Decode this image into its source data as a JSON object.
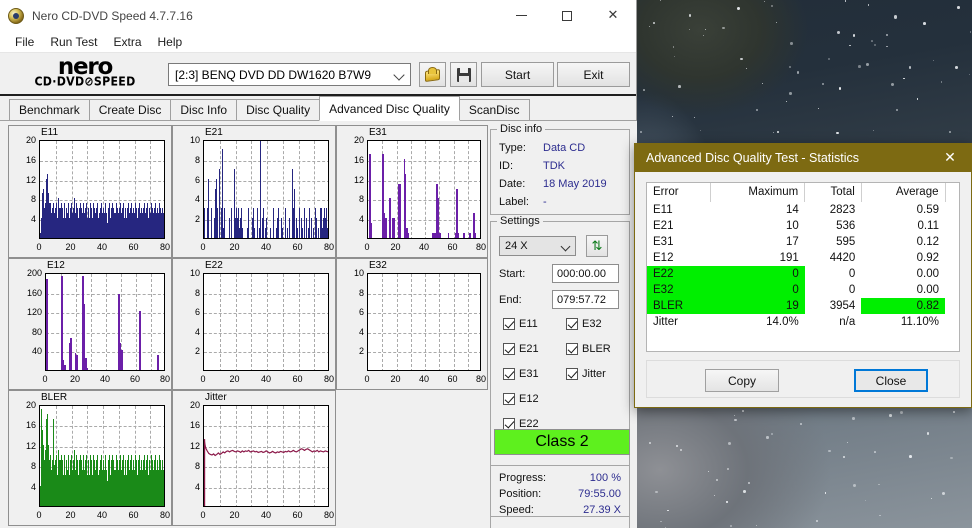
{
  "window": {
    "title": "Nero CD-DVD Speed 4.7.7.16",
    "app_icon": "nero-disc-icon",
    "minimize": "minimize-icon",
    "maximize": "maximize-icon",
    "close": "close-icon"
  },
  "menu": {
    "items": [
      "File",
      "Run Test",
      "Extra",
      "Help"
    ]
  },
  "logo": {
    "line1": "nero",
    "line2": "CD·DVD⊘SPEED"
  },
  "toolbar": {
    "drive": "[2:3]   BENQ DVD DD DW1620 B7W9",
    "eject_icon": "eject-disc-icon",
    "save_icon": "floppy-save-icon",
    "start_label": "Start",
    "exit_label": "Exit"
  },
  "tabs": [
    {
      "label": "Benchmark",
      "active": false
    },
    {
      "label": "Create Disc",
      "active": false
    },
    {
      "label": "Disc Info",
      "active": false
    },
    {
      "label": "Disc Quality",
      "active": false
    },
    {
      "label": "Advanced Disc Quality",
      "active": true
    },
    {
      "label": "ScanDisc",
      "active": false
    }
  ],
  "disc_info": {
    "legend": "Disc info",
    "rows": [
      {
        "label": "Type:",
        "value": "Data CD"
      },
      {
        "label": "ID:",
        "value": "TDK"
      },
      {
        "label": "Date:",
        "value": "18 May 2019"
      },
      {
        "label": "Label:",
        "value": "-"
      }
    ]
  },
  "settings": {
    "legend": "Settings",
    "speed": "24 X",
    "refresh_icon": "refresh-arrows-icon",
    "start_label": "Start:",
    "start_value": "000:00.00",
    "end_label": "End:",
    "end_value": "079:57.72",
    "checkboxes_left": [
      {
        "label": "E11",
        "checked": true
      },
      {
        "label": "E21",
        "checked": true
      },
      {
        "label": "E31",
        "checked": true
      },
      {
        "label": "E12",
        "checked": true
      },
      {
        "label": "E22",
        "checked": true
      }
    ],
    "checkboxes_right": [
      {
        "label": "E32",
        "checked": true
      },
      {
        "label": "BLER",
        "checked": true
      },
      {
        "label": "Jitter",
        "checked": true
      }
    ]
  },
  "class_box": {
    "label": "Class 2",
    "color": "#5ef01e"
  },
  "progress": {
    "rows": [
      {
        "label": "Progress:",
        "value": "100 %"
      },
      {
        "label": "Position:",
        "value": "79:55.00"
      },
      {
        "label": "Speed:",
        "value": "27.39 X"
      }
    ]
  },
  "dialog": {
    "title": "Advanced Disc Quality Test - Statistics",
    "close_icon": "close-icon",
    "columns": [
      "Error",
      "Maximum",
      "Total",
      "Average"
    ],
    "rows": [
      {
        "error": "E11",
        "maximum": "14",
        "total": "2823",
        "average": "0.59",
        "hl_left": false,
        "hl_avg": false
      },
      {
        "error": "E21",
        "maximum": "10",
        "total": "536",
        "average": "0.11",
        "hl_left": false,
        "hl_avg": false
      },
      {
        "error": "E31",
        "maximum": "17",
        "total": "595",
        "average": "0.12",
        "hl_left": false,
        "hl_avg": false
      },
      {
        "error": "E12",
        "maximum": "191",
        "total": "4420",
        "average": "0.92",
        "hl_left": false,
        "hl_avg": false
      },
      {
        "error": "E22",
        "maximum": "0",
        "total": "0",
        "average": "0.00",
        "hl_left": true,
        "hl_avg": false
      },
      {
        "error": "E32",
        "maximum": "0",
        "total": "0",
        "average": "0.00",
        "hl_left": true,
        "hl_avg": false
      },
      {
        "error": "BLER",
        "maximum": "19",
        "total": "3954",
        "average": "0.82",
        "hl_left": true,
        "hl_avg": true
      },
      {
        "error": "Jitter",
        "maximum": "14.0%",
        "total": "n/a",
        "average": "11.10%",
        "hl_left": false,
        "hl_avg": false
      }
    ],
    "copy_label": "Copy",
    "close_label": "Close"
  },
  "chart_data": [
    {
      "type": "bar",
      "title": "E11",
      "xlabel": "",
      "ylabel": "",
      "xlim": [
        0,
        80
      ],
      "ylim": [
        0,
        20
      ],
      "xticks": [
        0,
        20,
        40,
        60,
        80
      ],
      "yticks": [
        4,
        8,
        12,
        16,
        20
      ],
      "color": "#262680",
      "grid": true,
      "values": [
        1,
        2,
        4,
        6,
        9,
        5,
        10,
        6,
        5,
        4,
        7,
        12,
        5,
        6,
        13,
        9,
        7,
        6,
        4,
        7,
        3,
        5,
        6,
        4,
        3,
        7,
        5,
        4,
        6,
        3,
        5,
        7,
        4,
        3,
        8,
        6,
        5,
        3,
        6,
        4,
        7,
        6,
        5,
        3,
        4,
        7,
        5,
        4,
        6,
        3,
        5,
        4,
        7,
        6,
        4,
        3,
        5,
        6,
        4,
        7,
        5,
        3,
        4,
        6,
        8,
        5,
        3,
        7,
        4,
        6,
        5,
        3,
        4,
        6,
        5,
        7,
        4,
        3,
        6,
        5,
        4,
        7,
        5,
        3,
        6,
        4,
        5,
        7,
        3,
        4,
        6,
        5,
        4,
        3,
        7,
        5,
        6,
        4,
        3,
        5,
        7,
        4,
        6,
        5,
        3,
        4,
        6,
        5,
        7,
        3,
        4,
        5,
        6,
        4,
        3,
        7,
        5,
        4,
        6,
        3,
        5,
        4,
        7,
        6,
        4,
        5,
        3,
        6,
        4,
        7,
        5,
        3,
        4,
        6,
        5,
        4,
        7,
        3,
        6,
        5,
        4,
        3,
        5,
        7,
        4,
        6,
        3,
        5,
        4,
        6,
        7,
        3,
        5,
        4,
        6,
        5,
        3,
        7,
        4,
        6,
        5,
        4,
        3,
        6,
        5,
        7,
        4,
        3,
        5,
        6,
        4,
        7,
        3,
        5,
        4,
        6,
        5,
        3,
        4,
        7,
        6,
        5,
        3,
        4,
        6,
        5,
        4,
        7,
        3,
        5,
        6,
        4,
        5,
        3,
        6,
        4,
        7,
        5,
        3,
        4,
        6,
        5,
        7,
        4,
        3,
        6,
        5,
        4,
        3,
        7,
        5,
        6,
        4,
        5,
        3,
        6,
        4,
        7,
        3,
        5,
        6,
        4,
        5,
        3,
        7,
        4,
        6,
        5,
        3,
        4,
        6,
        5,
        4,
        7,
        3,
        5,
        6
      ],
      "ymax_label": "20"
    },
    {
      "type": "bar",
      "title": "E21",
      "xlabel": "",
      "ylabel": "",
      "xlim": [
        0,
        80
      ],
      "ylim": [
        0,
        10
      ],
      "xticks": [
        0,
        20,
        40,
        60,
        80
      ],
      "yticks": [
        2,
        4,
        6,
        8,
        10
      ],
      "color": "#262680",
      "grid": true,
      "values": [
        3,
        0,
        0,
        3,
        6,
        0,
        0,
        3,
        0,
        0,
        2,
        0,
        5,
        6,
        3,
        0,
        7,
        0,
        3,
        9,
        1,
        3,
        0,
        0,
        0,
        0,
        2,
        0,
        3,
        0,
        0,
        7,
        2,
        3,
        1,
        2,
        3,
        1,
        2,
        3,
        1,
        0,
        0,
        0,
        0,
        1,
        3,
        0,
        0,
        0,
        2,
        3,
        1,
        0,
        0,
        0,
        3,
        0,
        1,
        10,
        0,
        2,
        3,
        0,
        1,
        2,
        0,
        0,
        0,
        1,
        0,
        0,
        3,
        0,
        0,
        1,
        2,
        0,
        3,
        0,
        0,
        2,
        1,
        0,
        0,
        3,
        0,
        1,
        0,
        2,
        0,
        0,
        7,
        3,
        5,
        0,
        2,
        1,
        0,
        0,
        3,
        0,
        2,
        1,
        0,
        3,
        0,
        2,
        0,
        1,
        3,
        0,
        2,
        0,
        1,
        0,
        3,
        2,
        0,
        1,
        0,
        3,
        2,
        3,
        1,
        2,
        3,
        2,
        3,
        1,
        2,
        3
      ],
      "ymax_label": "10"
    },
    {
      "type": "bar",
      "title": "E31",
      "xlabel": "",
      "ylabel": "",
      "xlim": [
        0,
        80
      ],
      "ylim": [
        0,
        20
      ],
      "xticks": [
        0,
        20,
        40,
        60,
        80
      ],
      "yticks": [
        4,
        8,
        12,
        16,
        20
      ],
      "color": "#6b1fa8",
      "grid": true,
      "values": [
        0,
        17,
        3,
        0,
        0,
        0,
        0,
        0,
        0,
        0,
        17,
        5,
        4,
        0,
        0,
        8,
        0,
        4,
        4,
        0,
        0,
        11,
        11,
        0,
        0,
        16,
        13,
        2,
        1,
        0,
        0,
        0,
        0,
        0,
        0,
        0,
        0,
        0,
        0,
        0,
        0,
        0,
        0,
        0,
        0,
        1,
        1,
        1,
        11,
        8,
        1,
        0,
        0,
        0,
        0,
        0,
        1,
        0,
        0,
        0,
        0,
        1,
        10,
        1,
        0,
        0,
        0,
        1,
        0,
        0,
        0,
        1,
        0,
        0,
        5,
        1,
        0,
        0,
        0,
        3
      ],
      "ymax_label": "20"
    },
    {
      "type": "bar",
      "title": "E12",
      "xlabel": "",
      "ylabel": "",
      "xlim": [
        0,
        80
      ],
      "ylim": [
        0,
        200
      ],
      "xticks": [
        0,
        20,
        40,
        60,
        80
      ],
      "yticks": [
        40,
        80,
        120,
        160,
        200
      ],
      "color": "#6b1fa8",
      "grid": true,
      "values": [
        185,
        0,
        0,
        0,
        0,
        0,
        0,
        0,
        0,
        0,
        191,
        20,
        10,
        0,
        0,
        55,
        65,
        0,
        0,
        35,
        30,
        0,
        0,
        0,
        191,
        135,
        25,
        5,
        0,
        0,
        0,
        0,
        0,
        0,
        0,
        0,
        0,
        0,
        0,
        0,
        0,
        0,
        0,
        0,
        0,
        0,
        0,
        0,
        155,
        55,
        40,
        0,
        0,
        0,
        0,
        0,
        0,
        0,
        0,
        0,
        0,
        0,
        120,
        0,
        0,
        0,
        0,
        0,
        0,
        0,
        0,
        0,
        0,
        0,
        30,
        0,
        0,
        0,
        0,
        25
      ],
      "ymax_label": "200"
    },
    {
      "type": "bar",
      "title": "E22",
      "xlabel": "",
      "ylabel": "",
      "xlim": [
        0,
        80
      ],
      "ylim": [
        0,
        10
      ],
      "xticks": [
        0,
        20,
        40,
        60,
        80
      ],
      "yticks": [
        2,
        4,
        6,
        8,
        10
      ],
      "color": "#262680",
      "grid": true,
      "values": [],
      "ymax_label": "10"
    },
    {
      "type": "bar",
      "title": "E32",
      "xlabel": "",
      "ylabel": "",
      "xlim": [
        0,
        80
      ],
      "ylim": [
        0,
        10
      ],
      "xticks": [
        0,
        20,
        40,
        60,
        80
      ],
      "yticks": [
        2,
        4,
        6,
        8,
        10
      ],
      "color": "#6b1fa8",
      "grid": true,
      "values": [],
      "ymax_label": "10"
    },
    {
      "type": "bar",
      "title": "BLER",
      "xlabel": "",
      "ylabel": "",
      "xlim": [
        0,
        80
      ],
      "ylim": [
        0,
        20
      ],
      "xticks": [
        0,
        20,
        40,
        60,
        80
      ],
      "yticks": [
        4,
        8,
        12,
        16,
        20
      ],
      "color": "#1a8a18",
      "grid": true,
      "values": [
        4,
        7,
        19,
        15,
        9,
        8,
        12,
        6,
        9,
        7,
        11,
        17,
        8,
        9,
        18,
        12,
        9,
        8,
        6,
        10,
        5,
        7,
        9,
        6,
        5,
        17,
        8,
        6,
        9,
        5,
        7,
        10,
        6,
        5,
        11,
        9,
        7,
        5,
        9,
        6,
        10,
        9,
        7,
        5,
        6,
        10,
        7,
        6,
        9,
        5,
        7,
        6,
        10,
        9,
        6,
        5,
        7,
        9,
        6,
        10,
        7,
        5,
        6,
        9,
        11,
        7,
        5,
        10,
        6,
        9,
        7,
        5,
        6,
        9,
        7,
        10,
        6,
        5,
        9,
        7,
        6,
        10,
        7,
        5,
        9,
        6,
        7,
        10,
        5,
        6,
        9,
        7,
        6,
        5,
        10,
        7,
        9,
        6,
        5,
        7,
        10,
        6,
        9,
        7,
        5,
        6,
        9,
        7,
        10,
        5,
        6,
        7,
        9,
        6,
        5,
        10,
        7,
        6,
        9,
        5,
        7,
        6,
        10,
        9,
        6,
        7,
        5,
        9,
        6,
        10,
        7,
        5,
        6,
        9,
        7,
        6,
        10,
        5,
        9,
        7,
        6,
        5,
        7,
        10,
        6,
        9,
        5,
        7,
        6,
        9,
        10,
        5,
        7,
        6,
        9,
        7,
        5,
        10,
        6,
        9,
        7,
        6,
        5,
        9,
        7,
        10,
        6,
        5,
        7,
        9,
        6,
        10,
        5,
        7,
        6,
        9,
        7,
        5,
        6,
        10,
        9,
        7,
        5,
        6,
        9,
        7,
        6,
        10,
        5,
        7,
        9,
        6,
        7,
        5,
        9,
        6,
        10,
        7,
        5,
        6,
        9,
        7,
        10,
        6,
        5,
        9,
        7,
        6,
        5,
        10,
        7,
        9,
        6,
        7,
        5,
        9,
        6,
        10,
        5,
        7,
        9,
        6,
        7,
        5,
        10,
        6,
        9,
        7,
        5,
        6,
        9,
        7,
        6,
        10,
        5,
        7,
        13
      ],
      "ymax_label": "20"
    },
    {
      "type": "line",
      "title": "Jitter",
      "xlabel": "",
      "ylabel": "",
      "xlim": [
        0,
        80
      ],
      "ylim": [
        0,
        20
      ],
      "xticks": [
        0,
        20,
        40,
        60,
        80
      ],
      "yticks": [
        4,
        8,
        12,
        16,
        20
      ],
      "color": "#8c1a4a",
      "grid": true,
      "values": [
        13.5,
        11.8,
        11.2,
        10.7,
        10.5,
        10.4,
        10.6,
        10.3,
        10.5,
        10.8,
        10.5,
        10.7,
        11.0,
        10.8,
        11.1,
        11.2,
        11.0,
        11.2,
        11.3,
        11.1,
        11.0,
        11.2,
        11.1,
        10.9,
        11.2,
        11.0,
        11.2,
        11.1,
        11.3,
        11.0,
        11.1,
        11.2,
        11.0,
        11.1,
        10.9,
        11.0,
        11.1,
        10.9,
        11.0,
        11.2,
        11.0,
        10.8,
        10.9,
        11.1,
        10.9,
        10.8,
        11.0,
        10.9,
        11.1,
        11.0,
        10.9,
        11.1,
        11.0,
        11.2,
        11.0,
        11.1,
        11.3,
        11.1,
        11.0,
        11.2,
        11.4,
        11.6,
        11.5,
        11.3,
        11.5,
        11.6,
        11.4,
        11.2,
        11.0,
        11.2,
        11.1,
        11.3,
        11.0,
        11.2,
        11.1,
        11.0,
        11.2,
        11.1,
        11.0,
        11.2
      ],
      "ymax_label": "20"
    }
  ]
}
